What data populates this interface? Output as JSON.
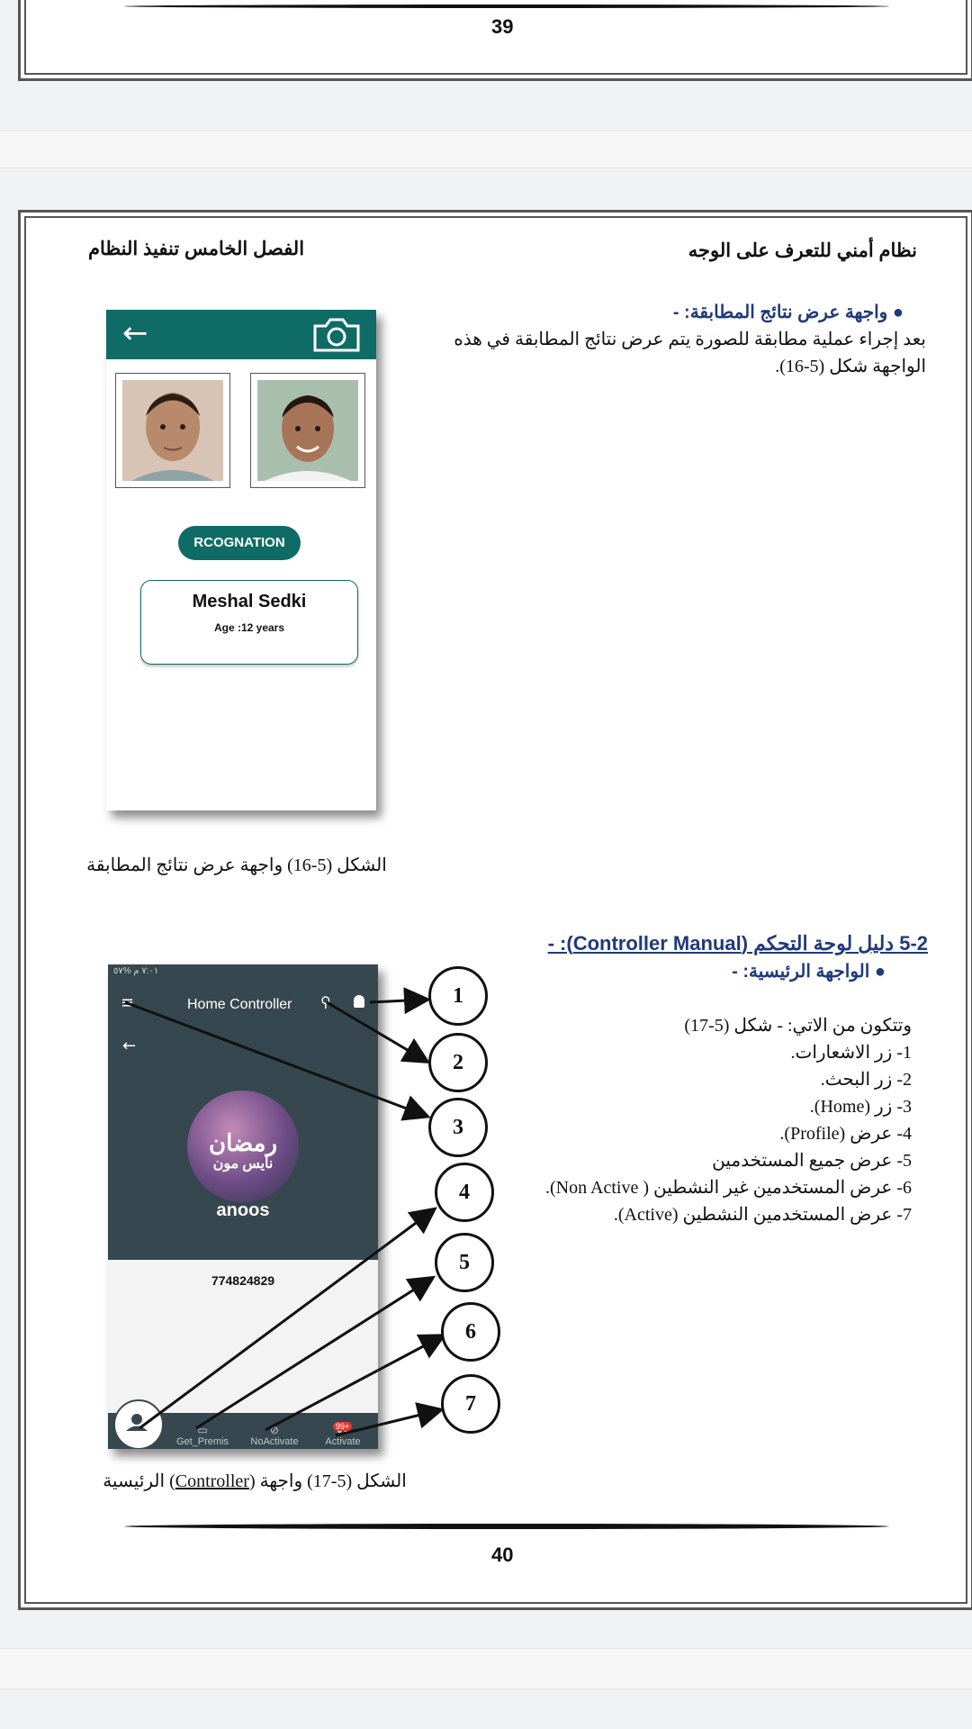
{
  "page_top": {
    "page_number": "39"
  },
  "page_bottom": {
    "header_right": "نظام أمني للتعرف على الوجه",
    "header_left": "الفصل الخامس تنفيذ النظام",
    "section1": {
      "heading": "واجهة عرض نتائج المطابقة: -",
      "body": "بعد إجراء عملية مطابقة للصورة يتم عرض نتائج المطابقة في هذه الواجهة شكل (5-16)."
    },
    "figure16": {
      "button_label": "RCOGNATION",
      "name": "Meshal Sedki",
      "age": "Age :12 years",
      "caption": "الشكل (5-16) واجهة عرض نتائج المطابقة"
    },
    "section2": {
      "title": "5-2 دليل لوحة التحكم (Controller Manual): -",
      "subheading": "الواجهة الرئيسية: -",
      "intro": "وتتكون من الاتي: - شكل (5-17)",
      "items": [
        "1- زر الاشعارات.",
        "2- زر البحث.",
        "3- زر (Home).",
        "4- عرض (Profile).",
        "5- عرض جميع المستخدمين",
        "6- عرض المستخدمين غير النشطين ( Non Active).",
        "7- عرض المستخدمين النشطين (Active)."
      ]
    },
    "figure17": {
      "status_bar": "٧:٠١ م  %٥٧",
      "app_title": "Home Controller",
      "avatar_text_ar_1": "رمضان",
      "avatar_text_ar_2": "نايس مون",
      "avatar_name": "anoos",
      "phone_number": "774824829",
      "nav": [
        "Get_Premis",
        "NoActivate",
        "Activate"
      ],
      "badge": "99+",
      "callouts": [
        "1",
        "2",
        "3",
        "4",
        "5",
        "6",
        "7"
      ],
      "caption_pre": "الشكل (5-17) واجهة (",
      "caption_link": "Controller",
      "caption_post": ") الرئيسية"
    },
    "page_number": "40"
  },
  "colors": {
    "teal": "#0f6b66",
    "slate": "#37474f",
    "heading_blue": "#1f3a7a"
  }
}
